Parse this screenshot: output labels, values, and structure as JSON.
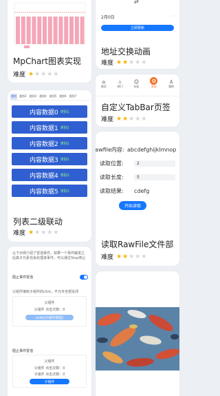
{
  "cards": {
    "mpchart": {
      "title": "MpChart图表实现",
      "difficulty_label": "难度",
      "stars": 1,
      "legend": ""
    },
    "address": {
      "title": "地址交换动画",
      "difficulty_label": "难度",
      "stars": 2,
      "date_text": "2月0日",
      "button_label": "立即更新"
    },
    "tabbar": {
      "title": "自定义TabBar页签",
      "difficulty_label": "难度",
      "stars": 2,
      "tabs": [
        {
          "label": "首页",
          "icon": "home-icon"
        },
        {
          "label": "热门",
          "icon": "fire-icon"
        },
        {
          "label": "社区",
          "icon": "community-icon"
        },
        {
          "label": "发现",
          "icon": "discover-icon"
        },
        {
          "label": "我的",
          "icon": "user-icon"
        }
      ]
    },
    "list": {
      "title": "列表二级联动",
      "difficulty_label": "难度",
      "stars": 1,
      "categories": [
        "类别",
        "类别2",
        "类别3",
        "类别4",
        "类别5",
        "类别6",
        "类别7"
      ],
      "items": [
        {
          "text": "内容数据0",
          "tag": "类别1"
        },
        {
          "text": "内容数据1",
          "tag": "类别1"
        },
        {
          "text": "内容数据2",
          "tag": "类别1"
        },
        {
          "text": "内容数据3",
          "tag": "类别1"
        },
        {
          "text": "内容数据4",
          "tag": "类别1"
        },
        {
          "text": "内容数据5",
          "tag": "类别1"
        }
      ]
    },
    "rawfile": {
      "title": "读取RawFile文件部",
      "difficulty_label": "难度",
      "stars": 2,
      "rows": [
        {
          "label": "rawfile内容:",
          "value": "abcdefghijklmnop"
        },
        {
          "label": "读取位置:",
          "value": "2"
        },
        {
          "label": "读取长度:",
          "value": "5"
        },
        {
          "label": "读取结果:",
          "value": "cdefg"
        }
      ],
      "button_label": "开始读取"
    },
    "event": {
      "intro": "以下示例介绍了冒泡事件，如果一个事件触发之后其子元素也会处理该事件，可以通过Stop停止",
      "switch_label": "阻止事件冒泡",
      "section1_desc": "父组件接收子组件的click，不允许全部关闭",
      "parent_label": "父组件",
      "count_label": "父组件 点击次数：0",
      "child_button": "child(子组件按钮)",
      "section2_title": "阻止事件冒泡",
      "parent2_label": "父组件",
      "parent2_count": "父组件 点击次数：0",
      "child2_count": "子组件 点击次数：0",
      "child2_button": "子组件"
    }
  },
  "colors": {
    "accent": "#1677ff",
    "bar_pink": "#f4a6b7",
    "item_blue": "#2f5fd0",
    "tag_green": "#8df58d"
  }
}
